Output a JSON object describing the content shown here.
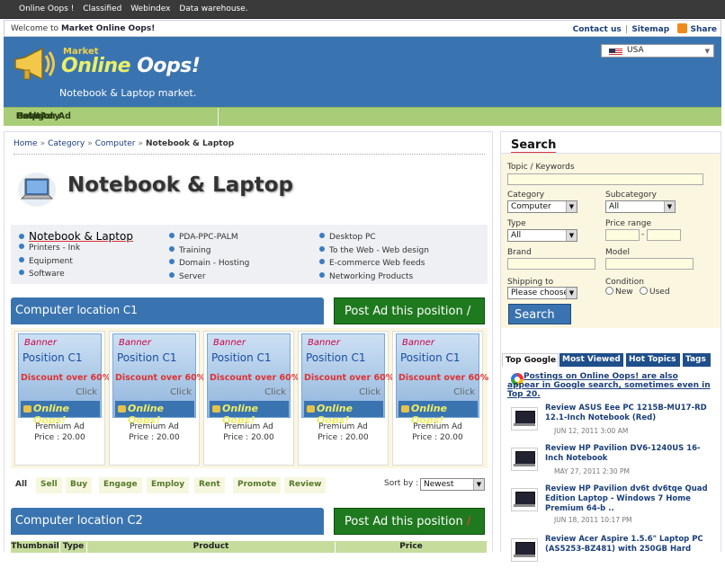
{
  "topbar": {
    "links": [
      "Online Oops !",
      "Classified",
      "Webindex",
      "Data warehouse."
    ]
  },
  "welcome": {
    "prefix": "Welcome to ",
    "site": "Market Online Oops!",
    "contact": "Contact us",
    "sep": "|",
    "sitemap": "Sitemap",
    "share": "Share"
  },
  "logo": {
    "market": "Market",
    "online": "Online ",
    "oops": "Oops!",
    "tagline": "Notebook & Laptop market."
  },
  "country": {
    "selected": "USA"
  },
  "nav": [
    "Home",
    "Post Ad",
    "Position Ad",
    "Category",
    "Help"
  ],
  "breadcrumb": {
    "items": [
      "Home",
      "Category",
      "Computer"
    ],
    "current": "Notebook & Laptop",
    "sep": "»"
  },
  "category": {
    "title": "Notebook & Laptop"
  },
  "subcats": {
    "col1": [
      "Notebook & Laptop",
      "Printers - Ink",
      "Equipment",
      "Software"
    ],
    "col2": [
      "PDA-PPC-PALM",
      "Training",
      "Domain - Hosting",
      "Server"
    ],
    "col3": [
      "Desktop PC",
      "To the Web - Web design",
      "E-commerce Web feeds",
      "Networking Products"
    ]
  },
  "section1": {
    "title_a": "Computer",
    "title_b": " location C1",
    "post": "Post Ad this position",
    "slash": "/"
  },
  "section2": {
    "title": "Computer location C2",
    "post": "Post Ad this position",
    "slash": "/"
  },
  "ads": [
    {
      "banner": "Banner",
      "position": "Position C1",
      "discount": "Discount over 60%",
      "click": "Click",
      "brand": "Online Oops!",
      "label": "Premium Ad",
      "price": "Price : 20.00"
    },
    {
      "banner": "Banner",
      "position": "Position C1",
      "discount": "Discount over 60%",
      "click": "Click",
      "brand": "Online Oops!",
      "label": "Premium Ad",
      "price": "Price : 20.00"
    },
    {
      "banner": "Banner",
      "position": "Position C1",
      "discount": "Discount over 60%",
      "click": "Click",
      "brand": "Online Oops!",
      "label": "Premium Ad",
      "price": "Price : 20.00"
    },
    {
      "banner": "Banner",
      "position": "Position C1",
      "discount": "Discount over 60%",
      "click": "Click",
      "brand": "Online Oops!",
      "label": "Premium Ad",
      "price": "Price : 20.00"
    },
    {
      "banner": "Banner",
      "position": "Position C1",
      "discount": "Discount over 60%",
      "click": "Click",
      "brand": "Online Oops!",
      "label": "Premium Ad",
      "price": "Price : 20.00"
    }
  ],
  "filters": [
    "All",
    "Sell",
    "Buy",
    "Engage",
    "Employ",
    "Rent",
    "Promote",
    "Review"
  ],
  "sort": {
    "label": "Sort by :",
    "selected": "Newest"
  },
  "table": {
    "headers": [
      "Thumbnail",
      "Type",
      "Product",
      "Price"
    ]
  },
  "search": {
    "title": "Search",
    "topic_label": "Topic / Keywords",
    "category_label": "Category",
    "category_value": "Computer",
    "subcategory_label": "Subcategory",
    "subcategory_value": "All",
    "type_label": "Type",
    "type_value": "All",
    "price_label": "Price range",
    "price_sep": "-",
    "brand_label": "Brand",
    "model_label": "Model",
    "shipping_label": "Shipping to",
    "shipping_value": "Please choose",
    "condition_label": "Condition",
    "cond_new": "New",
    "cond_used": "Used",
    "button": "Search"
  },
  "tabs": [
    "Top Google",
    "Most Viewed",
    "Hot Topics",
    "Tags"
  ],
  "google_intro": "Postings on Online Oops! are also appear in Google search, sometimes even in Top 20.",
  "news": [
    {
      "title": "Review ASUS Eee PC 1215B-MU17-RD 12.1-Inch Notebook (Red)",
      "date": "JUN 12, 2011 3:00 AM"
    },
    {
      "title": "Review HP Pavilion DV6-1240US 16-Inch Notebook",
      "date": "MAY 27, 2011 2:30 PM"
    },
    {
      "title": "Review HP Pavilion dv6t dv6tqe Quad Edition Laptop - Windows 7 Home Premium 64-b ..",
      "date": "JUN 18, 2011 10:17 PM"
    },
    {
      "title": "Review Acer Aspire 1.5.6\" Laptop PC (AS5253-BZ481) with 250GB Hard",
      "date": ""
    }
  ]
}
